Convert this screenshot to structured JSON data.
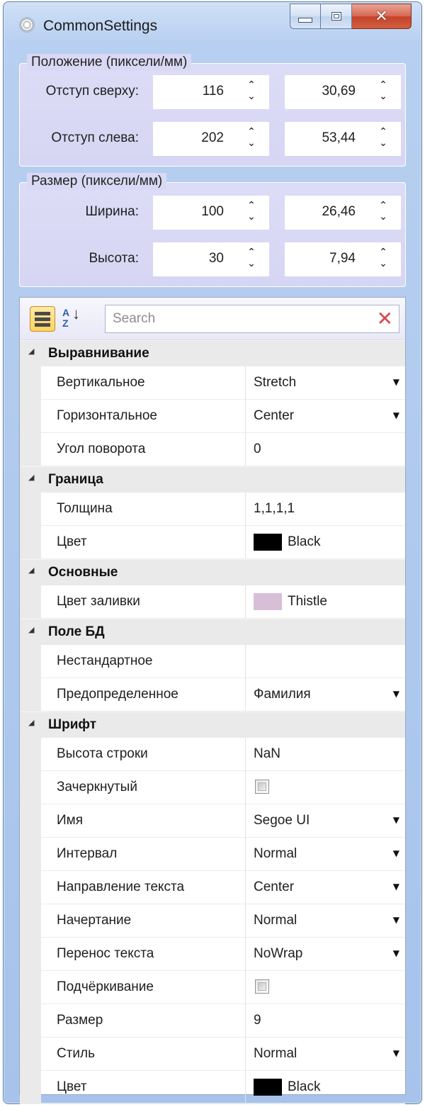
{
  "window": {
    "title": "CommonSettings",
    "icon": "gear-icon",
    "controls": {
      "minimize": "minimize-icon",
      "maximize": "maximize-icon",
      "close": "✕"
    }
  },
  "position_group": {
    "legend": "Положение (пиксели/мм)",
    "rows": [
      {
        "label": "Отступ сверху:",
        "px": "116",
        "mm": "30,69"
      },
      {
        "label": "Отступ слева:",
        "px": "202",
        "mm": "53,44"
      }
    ]
  },
  "size_group": {
    "legend": "Размер (пиксели/мм)",
    "rows": [
      {
        "label": "Ширина:",
        "px": "100",
        "mm": "26,46"
      },
      {
        "label": "Высота:",
        "px": "30",
        "mm": "7,94"
      }
    ]
  },
  "spin_arrows": "⌃⌄",
  "toolbar": {
    "categorized_icon": "categorized-view-icon",
    "sort_icon": "alphabetical-sort-icon",
    "sort_a": "A",
    "sort_z": "Z",
    "sort_arrow": "↓",
    "search_placeholder": "Search",
    "search_value": "",
    "clear_glyph": "✕"
  },
  "property_grid": {
    "categories": [
      {
        "name": "Выравнивание",
        "props": [
          {
            "name": "Вертикальное",
            "value": "Stretch",
            "dropdown": true
          },
          {
            "name": "Горизонтальное",
            "value": "Center",
            "dropdown": true
          },
          {
            "name": "Угол поворота",
            "value": "0",
            "dropdown": false
          }
        ]
      },
      {
        "name": "Граница",
        "props": [
          {
            "name": "Толщина",
            "value": "1,1,1,1",
            "dropdown": false
          },
          {
            "name": "Цвет",
            "value": "Black",
            "swatch": "#000000",
            "dropdown": false
          }
        ]
      },
      {
        "name": "Основные",
        "props": [
          {
            "name": "Цвет заливки",
            "value": "Thistle",
            "swatch": "#D8BFD8",
            "dropdown": false
          }
        ]
      },
      {
        "name": "Поле БД",
        "props": [
          {
            "name": "Нестандартное",
            "value": "",
            "dropdown": false
          },
          {
            "name": "Предопределенное",
            "value": "Фамилия",
            "dropdown": true
          }
        ]
      },
      {
        "name": "Шрифт",
        "props": [
          {
            "name": "Высота строки",
            "value": "NaN",
            "dropdown": false
          },
          {
            "name": "Зачеркнутый",
            "value": "",
            "checkbox": true,
            "checked": false,
            "dropdown": false
          },
          {
            "name": "Имя",
            "value": "Segoe UI",
            "dropdown": true
          },
          {
            "name": "Интервал",
            "value": "Normal",
            "dropdown": true
          },
          {
            "name": "Направление текста",
            "value": "Center",
            "dropdown": true
          },
          {
            "name": "Начертание",
            "value": "Normal",
            "dropdown": true
          },
          {
            "name": "Перенос текста",
            "value": "NoWrap",
            "dropdown": true
          },
          {
            "name": "Подчёркивание",
            "value": "",
            "checkbox": true,
            "checked": false,
            "dropdown": false
          },
          {
            "name": "Размер",
            "value": "9",
            "dropdown": false
          },
          {
            "name": "Стиль",
            "value": "Normal",
            "dropdown": true
          },
          {
            "name": "Цвет",
            "value": "Black",
            "swatch": "#000000",
            "dropdown": false
          }
        ]
      }
    ],
    "expanded_glyph": "◢",
    "dropdown_glyph": "▼"
  },
  "colors": {
    "window_frame": "#A7C3EB",
    "group_background": "#D6D6F4",
    "category_row": "#EAEAEA",
    "close_button": "#C5432C"
  }
}
